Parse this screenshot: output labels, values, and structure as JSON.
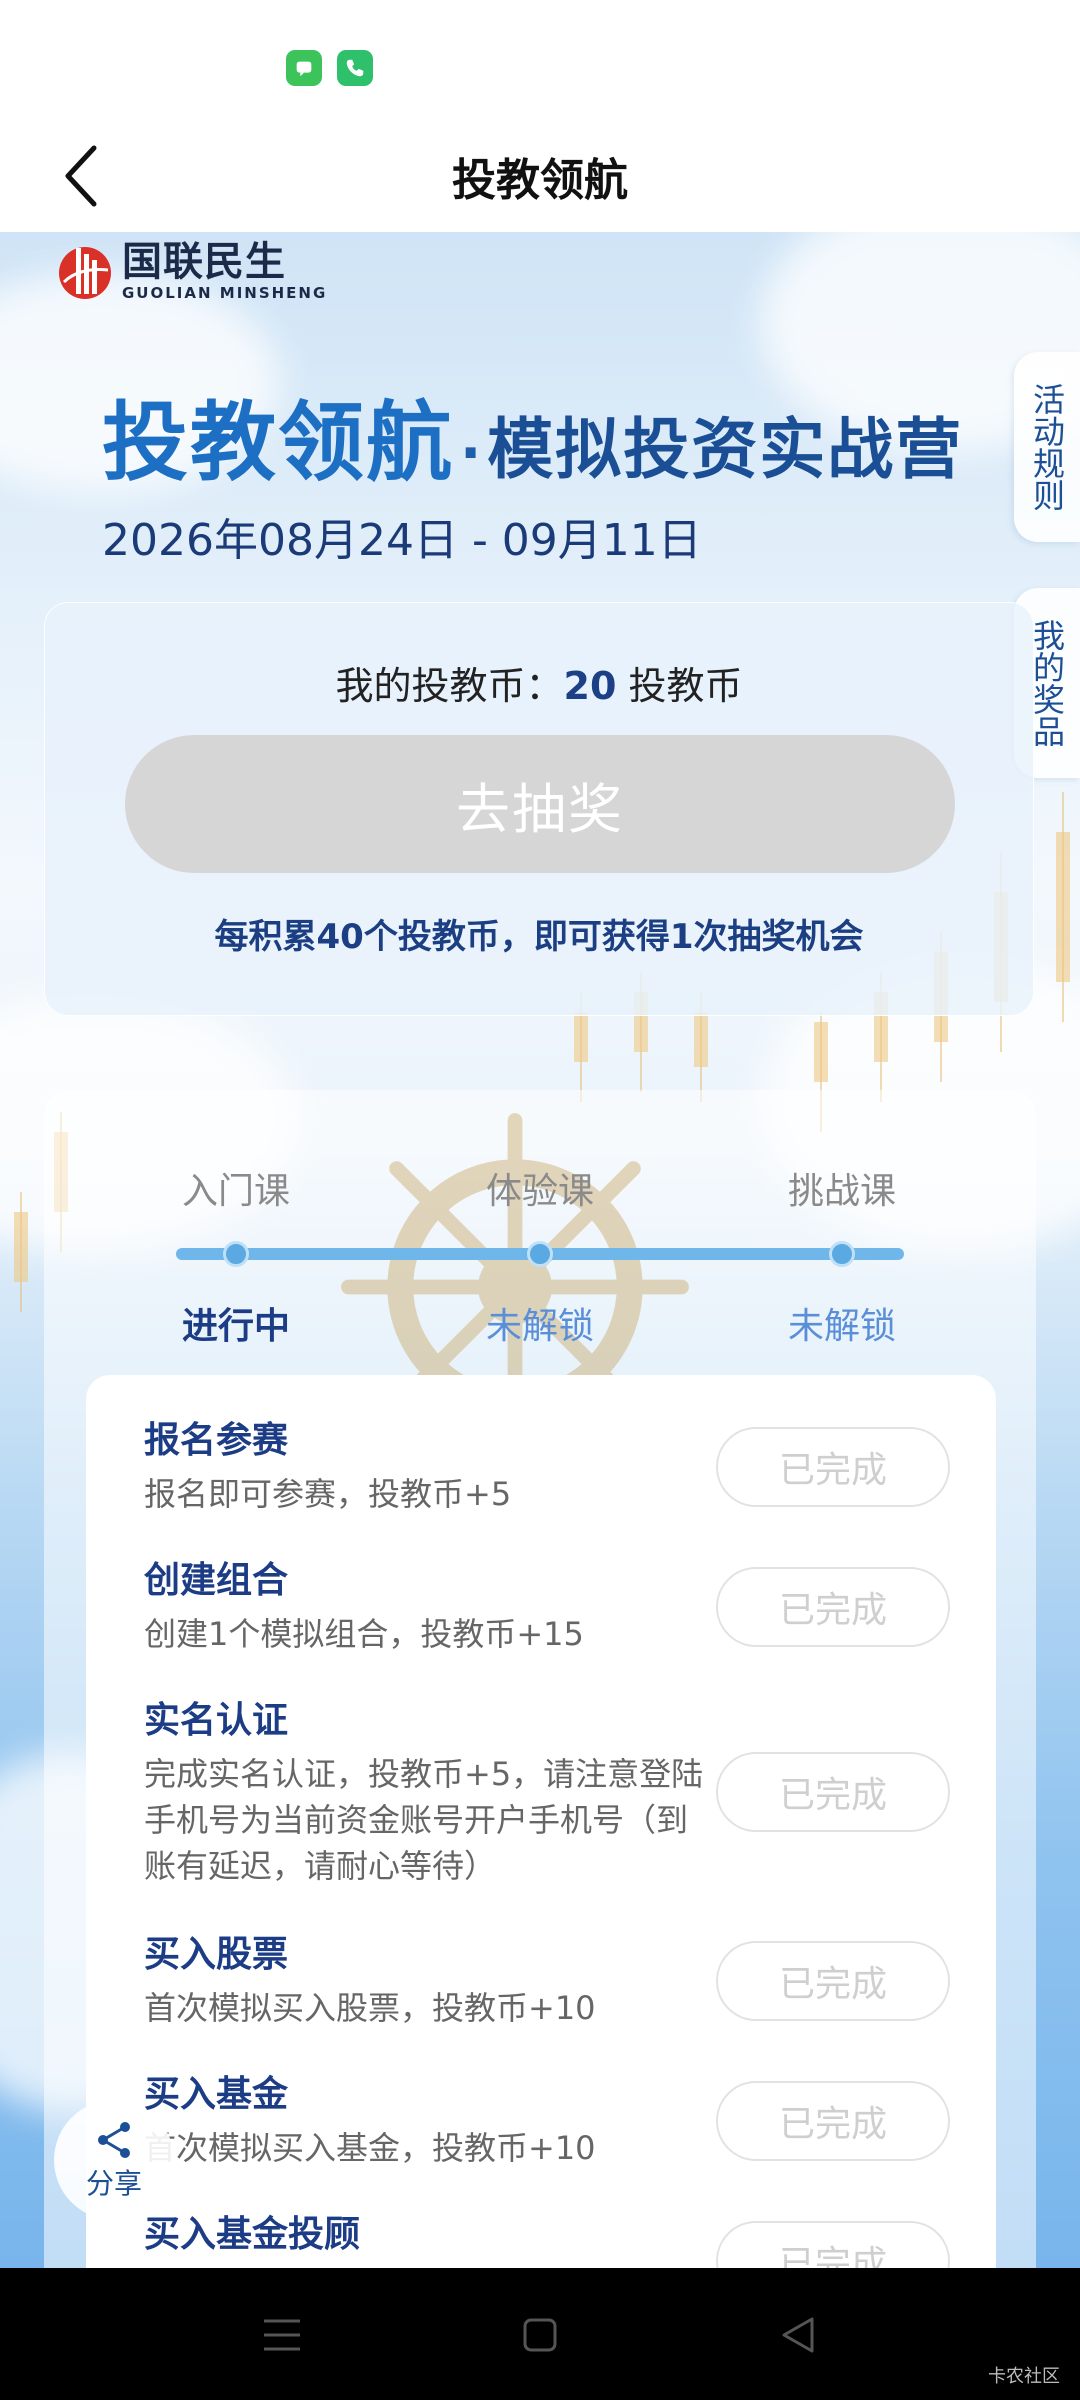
{
  "header": {
    "title": "投教领航"
  },
  "status_bar": {
    "icons": [
      "messages-icon",
      "phone-icon"
    ]
  },
  "hero": {
    "logo_cn": "国联民生",
    "logo_en": "GUOLIAN MINSHENG",
    "campaign_main": "投教领航",
    "campaign_dot": "·",
    "campaign_sub": "模拟投资实战营",
    "date_range": "2026年08月24日 - 09月11日"
  },
  "side_tabs": {
    "rules": "活动规则",
    "prizes": "我的奖品"
  },
  "coins": {
    "prefix": "我的投教币：",
    "value": "20",
    "suffix": " 投教币",
    "draw_button": "去抽奖",
    "tip": "每积累40个投教币，即可获得1次抽奖机会"
  },
  "courses": [
    {
      "label": "入门课",
      "status": "进行中",
      "status_color": "#1c3c86"
    },
    {
      "label": "体验课",
      "status": "未解锁",
      "status_color": "#5a8fd8"
    },
    {
      "label": "挑战课",
      "status": "未解锁",
      "status_color": "#5a8fd8"
    }
  ],
  "tasks": [
    {
      "title": "报名参赛",
      "desc": "报名即可参赛，投教币+5",
      "button": "已完成"
    },
    {
      "title": "创建组合",
      "desc": "创建1个模拟组合，投教币+15",
      "button": "已完成"
    },
    {
      "title": "实名认证",
      "desc": "完成实名认证，投教币+5，请注意登陆手机号为当前资金账号开户手机号（到账有延迟，请耐心等待）",
      "button": "已完成"
    },
    {
      "title": "买入股票",
      "desc": "首次模拟买入股票，投教币+10",
      "button": "已完成"
    },
    {
      "title": "买入基金",
      "desc": "首次模拟买入基金，投教币+10",
      "button": "已完成"
    },
    {
      "title": "买入基金投顾",
      "desc": "",
      "button": "已完成"
    }
  ],
  "share": {
    "label": "分享"
  },
  "watermark": "卡农社区",
  "colors": {
    "accent": "#1c3c86",
    "title_blue": "#1d6fc4",
    "disabled": "#d6d6d6"
  }
}
